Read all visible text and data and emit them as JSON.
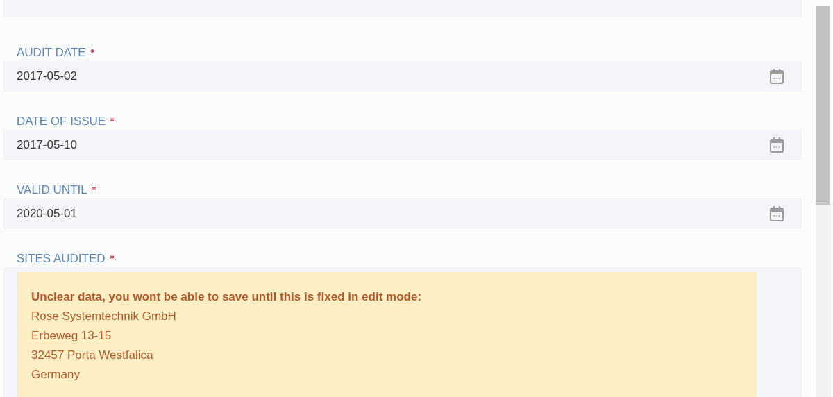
{
  "fields": [
    {
      "label": "AUDIT DATE",
      "required": true,
      "value": "2017-05-02",
      "kind": "date"
    },
    {
      "label": "DATE OF ISSUE",
      "required": true,
      "value": "2017-05-10",
      "kind": "date"
    },
    {
      "label": "VALID UNTIL",
      "required": true,
      "value": "2020-05-01",
      "kind": "date"
    }
  ],
  "sites_audited": {
    "label": "SITES AUDITED",
    "required": true,
    "warning": {
      "title": "Unclear data, you wont be able to save until this is fixed in edit mode:",
      "lines": [
        "Rose Systemtechnik GmbH",
        "Erbeweg 13-15",
        "32457 Porta Westfalica",
        "Germany"
      ]
    }
  }
}
